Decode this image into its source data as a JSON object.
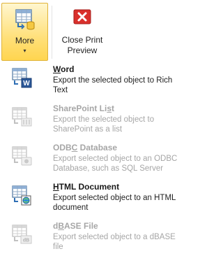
{
  "ribbon": {
    "more": {
      "label": "More",
      "icon": "table-export-icon"
    },
    "close_print_preview": {
      "label_line1": "Close Print",
      "label_line2": "Preview",
      "icon": "close-x-icon"
    }
  },
  "menu": {
    "items": [
      {
        "title_underlined": "W",
        "title_rest": "ord",
        "desc_line1": "Export the selected object to Rich",
        "desc_line2": "Text",
        "enabled": true,
        "icon": "word-export-icon"
      },
      {
        "title_pre": "SharePoint Li",
        "title_underlined": "s",
        "title_rest": "t",
        "desc_line1": "Export the selected object to",
        "desc_line2": "SharePoint as a list",
        "enabled": false,
        "icon": "sharepoint-export-icon"
      },
      {
        "title_pre": "ODB",
        "title_underlined": "C",
        "title_rest": " Database",
        "desc_line1": "Export selected object to an ODBC",
        "desc_line2": "Database, such as SQL Server",
        "enabled": false,
        "icon": "odbc-export-icon"
      },
      {
        "title_underlined": "H",
        "title_rest": "TML Document",
        "desc_line1": "Export selected object to an HTML",
        "desc_line2": "document",
        "enabled": true,
        "icon": "html-export-icon"
      },
      {
        "title_pre": "d",
        "title_underlined": "B",
        "title_rest": "ASE File",
        "desc_line1": "Export selected object to a dBASE",
        "desc_line2": "file",
        "enabled": false,
        "icon": "dbase-export-icon"
      }
    ]
  },
  "colors": {
    "highlight": "#ffe07a",
    "disabled_text": "#a6a6a6",
    "close_red": "#d9302c"
  }
}
